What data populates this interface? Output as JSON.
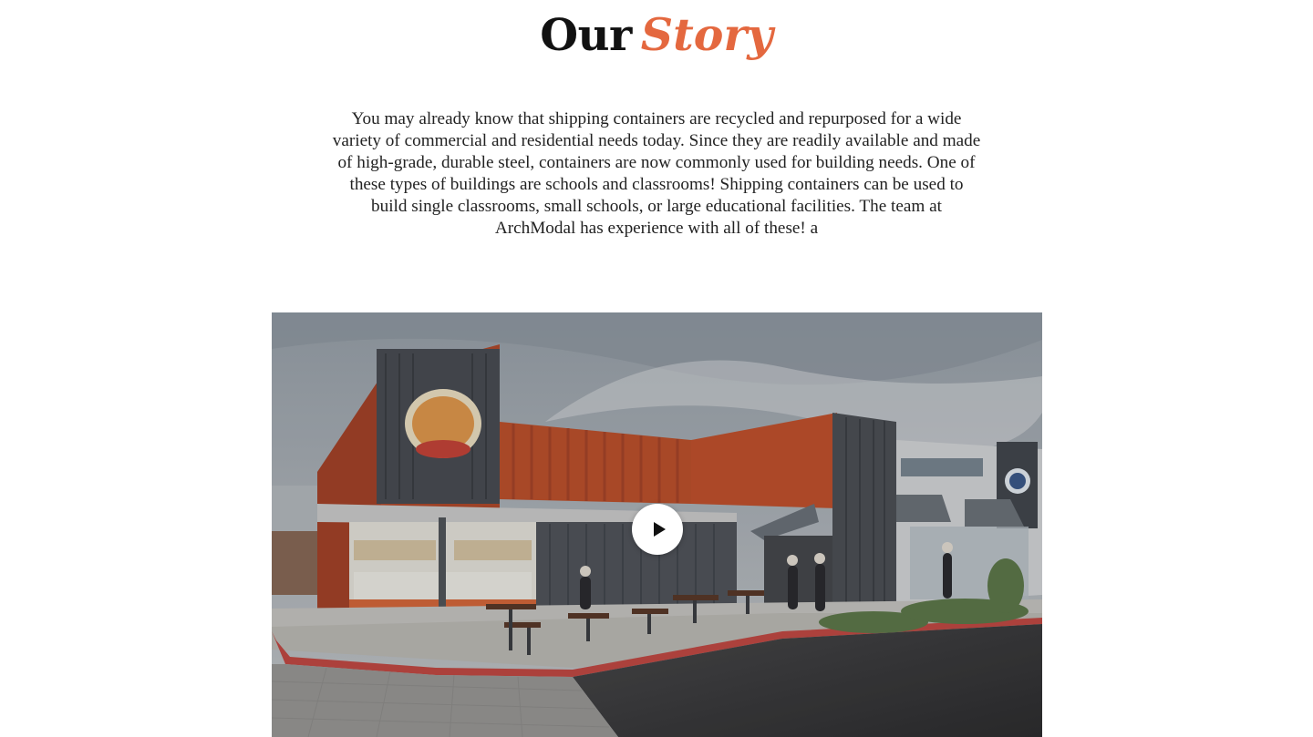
{
  "section": {
    "title_plain": "Our",
    "title_accent": "Story"
  },
  "story": {
    "paragraph": "You may already know that shipping containers are recycled and repurposed for a wide variety of commercial and residential needs today. Since they are readily available and made of high-grade, durable steel, containers are now commonly used for building needs. One of these types of buildings are schools and classrooms! Shipping containers can be used to build single classrooms, small schools, or large educational facilities. The team at ArchModal has experience with all of these! a"
  },
  "video": {
    "thumbnail": "shipping-container-restaurant-photo",
    "play_icon": "play-icon"
  },
  "colors": {
    "accent": "#e4683f",
    "heading": "#111111",
    "body_text": "#222222",
    "background": "#ffffff",
    "container_orange": "#c4532e",
    "container_gray": "#4e5157"
  }
}
